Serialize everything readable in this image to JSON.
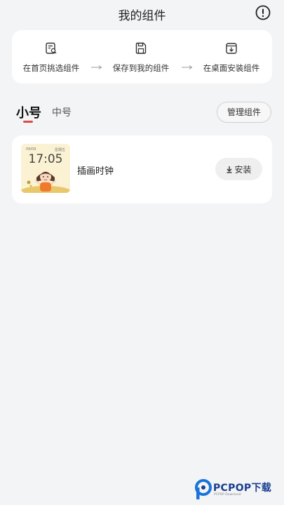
{
  "header": {
    "title": "我的组件",
    "info_icon": "exclamation-circle-icon"
  },
  "steps": [
    {
      "label": "在首页挑选组件",
      "icon": "search-document-icon"
    },
    {
      "label": "保存到我的组件",
      "icon": "save-icon"
    },
    {
      "label": "在桌面安装组件",
      "icon": "download-box-icon"
    }
  ],
  "tabs": {
    "small": "小号",
    "medium": "中号",
    "active": "small",
    "accent_color": "#e04848"
  },
  "manage_button": "管理组件",
  "widgets": [
    {
      "name": "插画时钟",
      "install_label": "安装",
      "preview": {
        "date": "09/09",
        "weekday": "星期五",
        "time": "17:05"
      }
    }
  ],
  "watermark": {
    "text": "PCPOP下载",
    "sub": "PCPOP Download"
  }
}
